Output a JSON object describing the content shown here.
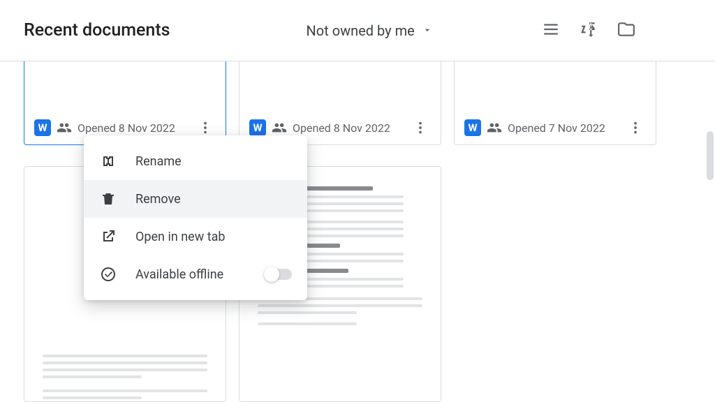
{
  "header": {
    "title": "Recent documents",
    "filter_label": "Not owned by me"
  },
  "docs": [
    {
      "meta": "Opened 8 Nov 2022"
    },
    {
      "meta": "Opened 8 Nov 2022"
    },
    {
      "meta": "Opened 7 Nov 2022"
    }
  ],
  "menu": {
    "rename": "Rename",
    "remove": "Remove",
    "newtab": "Open in new tab",
    "offline": "Available offline",
    "offline_on": false
  }
}
